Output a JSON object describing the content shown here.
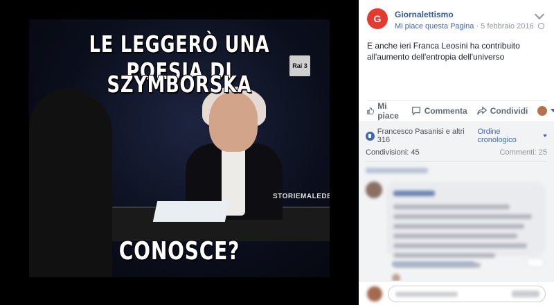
{
  "meme": {
    "top_line_1": "LE LEGGERÒ UNA POESIA DI",
    "top_line_2": "SZYMBORSKA",
    "bottom_line": "CONOSCE?",
    "channel_logo": "Rai 3",
    "watermark": "STORIEMALEDETTE"
  },
  "post": {
    "page_name": "Giornalettismo",
    "avatar_text": "G",
    "like_page": "Mi piace questa Pagina",
    "separator": "·",
    "date": "5 febbraio 2016",
    "text": "E anche ieri Franca Leosini ha contribuito all'aumento dell'entropia dell'universo"
  },
  "actions": {
    "like": "Mi piace",
    "comment": "Commenta",
    "share": "Condividi"
  },
  "reactions": {
    "summary": "Francesco Pasanisi e altri 316",
    "order": "Ordine cronologico"
  },
  "counts": {
    "shares": "Condivisioni: 45",
    "comments": "Commenti: 25"
  },
  "colors": {
    "brand": "#e53a2f",
    "link": "#4267b2",
    "page_name": "#365899"
  }
}
